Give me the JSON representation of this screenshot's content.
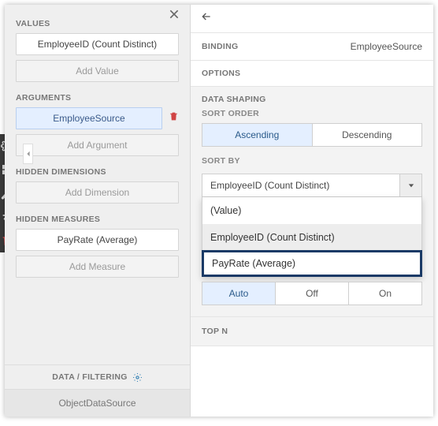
{
  "left": {
    "values_h": "VALUES",
    "value_item": "EmployeeID (Count Distinct)",
    "add_value": "Add Value",
    "arguments_h": "ARGUMENTS",
    "argument_item": "EmployeeSource",
    "add_argument": "Add Argument",
    "hidden_dim_h": "HIDDEN DIMENSIONS",
    "add_dimension": "Add Dimension",
    "hidden_meas_h": "HIDDEN MEASURES",
    "measure_item": "PayRate (Average)",
    "add_measure": "Add Measure",
    "data_filtering": "DATA / FILTERING",
    "datasource": "ObjectDataSource"
  },
  "right": {
    "binding_h": "BINDING",
    "binding_val": "EmployeeSource",
    "options_h": "OPTIONS",
    "shaping_h": "DATA SHAPING",
    "sortorder_h": "SORT ORDER",
    "asc": "Ascending",
    "desc": "Descending",
    "sortby_h": "SORT BY",
    "sortby_val": "EmployeeID (Count Distinct)",
    "menu": {
      "opt0": "(Value)",
      "opt1": "EmployeeID (Count Distinct)",
      "opt2": "PayRate (Average)"
    },
    "seg3": {
      "a": "Auto",
      "b": "Off",
      "c": "On"
    },
    "topn_h": "TOP N"
  }
}
